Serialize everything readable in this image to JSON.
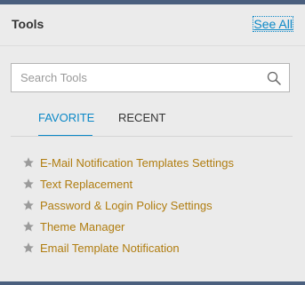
{
  "header": {
    "title": "Tools",
    "see_all_label": "See All"
  },
  "search": {
    "placeholder": "Search Tools",
    "icon": "search-icon"
  },
  "tabs": [
    {
      "label": "FAVORITE",
      "active": true
    },
    {
      "label": "RECENT",
      "active": false
    }
  ],
  "favorites": [
    {
      "label": "E-Mail Notification Templates Settings",
      "icon": "star-icon"
    },
    {
      "label": "Text Replacement",
      "icon": "star-icon"
    },
    {
      "label": "Password & Login Policy Settings",
      "icon": "star-icon"
    },
    {
      "label": "Theme Manager",
      "icon": "star-icon"
    },
    {
      "label": "Email Template Notification",
      "icon": "star-icon"
    }
  ],
  "colors": {
    "accent": "#0b88c7",
    "link": "#b07d10",
    "frame": "#4a5f7e",
    "background": "#ebebeb"
  }
}
